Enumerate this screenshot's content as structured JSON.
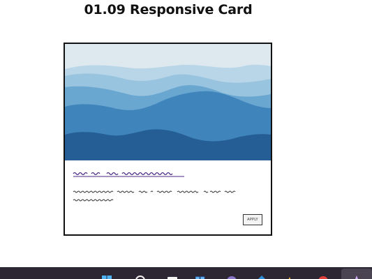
{
  "page": {
    "title": "01.09 Responsive Card"
  },
  "card": {
    "image_alt": "wave-landscape",
    "heading_text": "",
    "body_text": "",
    "apply_label": "APPLY"
  },
  "colors": {
    "sky": "#dde8ef",
    "wave_1": "#b9d6e8",
    "wave_2": "#99c4df",
    "wave_3": "#6aa7d0",
    "wave_4": "#3f85bc",
    "wave_5": "#245e95",
    "heading_scribble": "#4b2a86",
    "body_scribble": "#333333",
    "card_border": "#111111",
    "taskbar_bg": "#2d2733"
  },
  "taskbar": {
    "icons": [
      "windows-start-icon",
      "search-icon",
      "file-explorer-icon",
      "store-icon",
      "app-purple-icon",
      "app-blue-icon",
      "app-yellow-icon",
      "app-red-icon",
      "app-active-icon"
    ]
  }
}
